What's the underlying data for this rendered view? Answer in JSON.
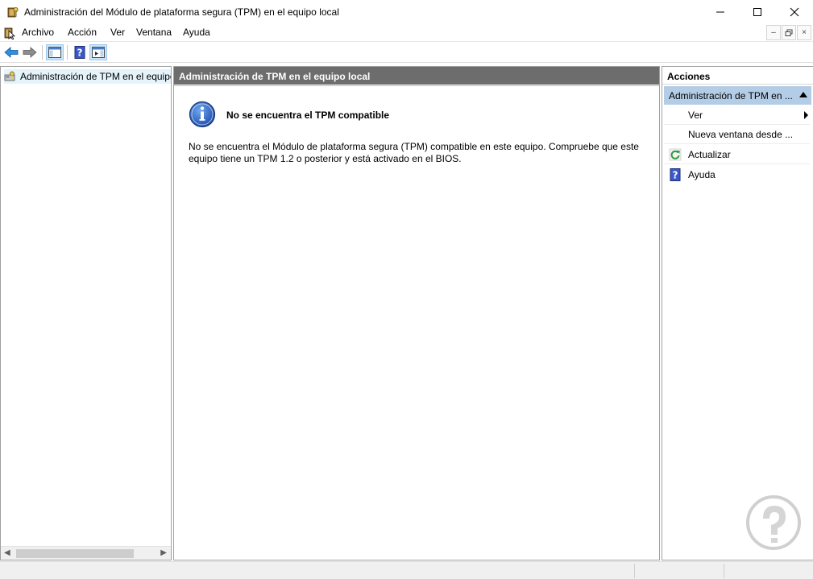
{
  "window": {
    "title": "Administración del Módulo de plataforma segura (TPM) en el equipo local",
    "minimize": "—",
    "maximize": "☐",
    "close": "✕"
  },
  "menu": {
    "items": [
      "Archivo",
      "Acción",
      "Ver",
      "Ventana",
      "Ayuda"
    ],
    "mdi_minimize": "–",
    "mdi_restore": "🗗",
    "mdi_close": "×"
  },
  "toolbar": {
    "icons": [
      "back-arrow-icon",
      "forward-arrow-icon",
      "show-hide-console-tree-icon",
      "help-icon",
      "show-hide-action-pane-icon"
    ]
  },
  "tree": {
    "root_label": "Administración de TPM en el equipo local"
  },
  "center": {
    "header": "Administración de TPM en el equipo local",
    "message_title": "No se encuentra el TPM compatible",
    "message_body": "No se encuentra el Módulo de plataforma segura (TPM) compatible en este equipo. Compruebe que este equipo tiene un TPM 1.2 o posterior y está activado en el BIOS."
  },
  "actions": {
    "header": "Acciones",
    "group_label": "Administración de TPM en ...",
    "items": [
      {
        "label": "Ver",
        "icon": "",
        "submenu": true
      },
      {
        "label": "Nueva ventana desde ...",
        "icon": "",
        "submenu": false
      },
      {
        "label": "Actualizar",
        "icon": "refresh-icon",
        "submenu": false
      },
      {
        "label": "Ayuda",
        "icon": "help-icon",
        "submenu": false
      }
    ]
  },
  "colors": {
    "center_header_bg": "#6d6d6d",
    "actions_group_bg": "#b4cde6",
    "toolbar_active_bg": "#cce4f7",
    "info_blue": "#1f5fbf"
  }
}
